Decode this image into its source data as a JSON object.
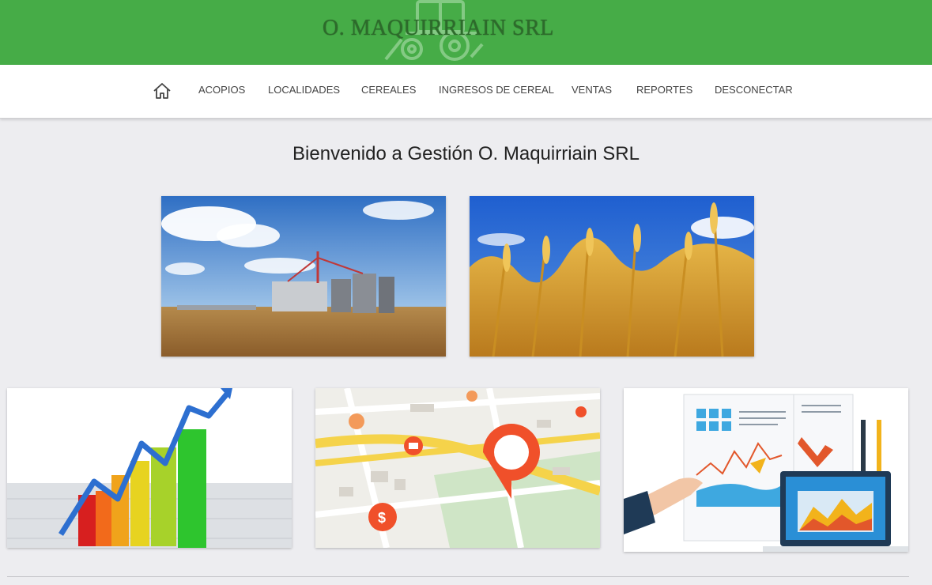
{
  "header": {
    "brand": "O. MAQUIRRIAIN SRL",
    "logo_icon": "tractor-icon",
    "background": "#46ac47"
  },
  "nav": {
    "home_icon": "home-icon",
    "items": [
      {
        "label": "ACOPIOS"
      },
      {
        "label": "LOCALIDADES"
      },
      {
        "label": "CEREALES"
      },
      {
        "label": "INGRESOS DE CEREAL"
      },
      {
        "label": "VENTAS"
      },
      {
        "label": "REPORTES"
      },
      {
        "label": "DESCONECTAR"
      }
    ]
  },
  "main": {
    "welcome": "Bienvenido a Gestión O. Maquirriain SRL",
    "tiles": [
      {
        "image": "grain-silos-photo"
      },
      {
        "image": "wheat-field-photo"
      },
      {
        "image": "growth-bar-chart-image"
      },
      {
        "image": "city-map-pins-image"
      },
      {
        "image": "reports-analytics-image"
      }
    ]
  }
}
